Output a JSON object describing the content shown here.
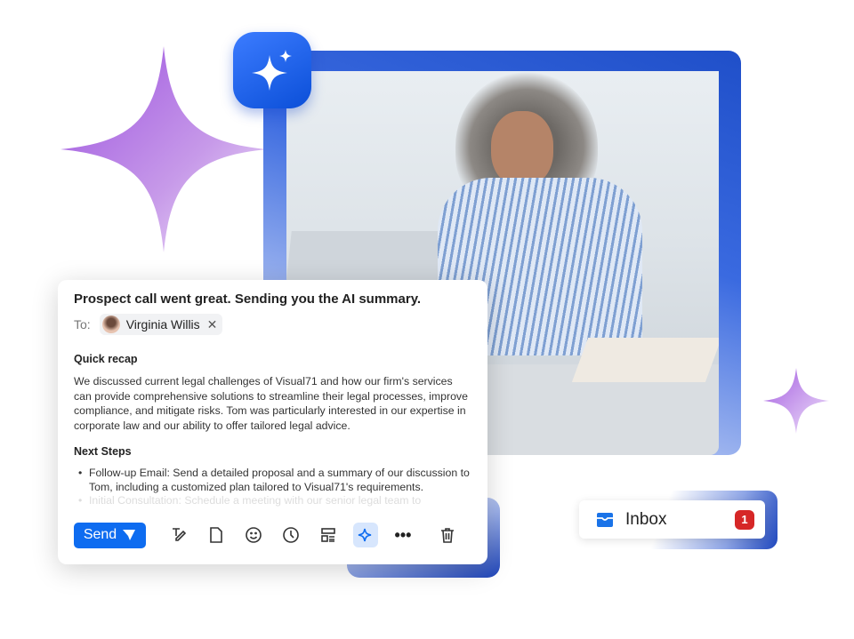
{
  "email": {
    "subject": "Prospect call went great. Sending you the AI summary.",
    "to_label": "To:",
    "recipient": "Virginia Willis",
    "remove_icon": "close-icon",
    "section1_title": "Quick recap",
    "section1_body": "We discussed current legal challenges of Visual71 and how our firm's services can provide comprehensive solutions to streamline their legal processes, improve compliance, and mitigate risks. Tom was particularly interested in our expertise in corporate law and our ability to offer tailored legal advice.",
    "section2_title": "Next Steps",
    "steps": [
      "Follow-up Email: Send a detailed proposal and a summary of our discussion to Tom, including a customized plan tailored to Visual71's requirements.",
      "Initial Consultation: Schedule a meeting with our senior legal team to"
    ],
    "toolbar": {
      "send_label": "Send",
      "icons": [
        "send-icon",
        "format-pen-icon",
        "file-icon",
        "emoji-icon",
        "clock-icon",
        "template-icon",
        "ai-sparkle-icon",
        "more-icon",
        "trash-icon"
      ]
    }
  },
  "inbox": {
    "label": "Inbox",
    "count": "1",
    "icon": "inbox-tray-icon"
  },
  "colors": {
    "accent": "#0e6cf0",
    "badge": "#d62727",
    "frame": "#1f4fc9",
    "sparkle": "#a66be0"
  }
}
